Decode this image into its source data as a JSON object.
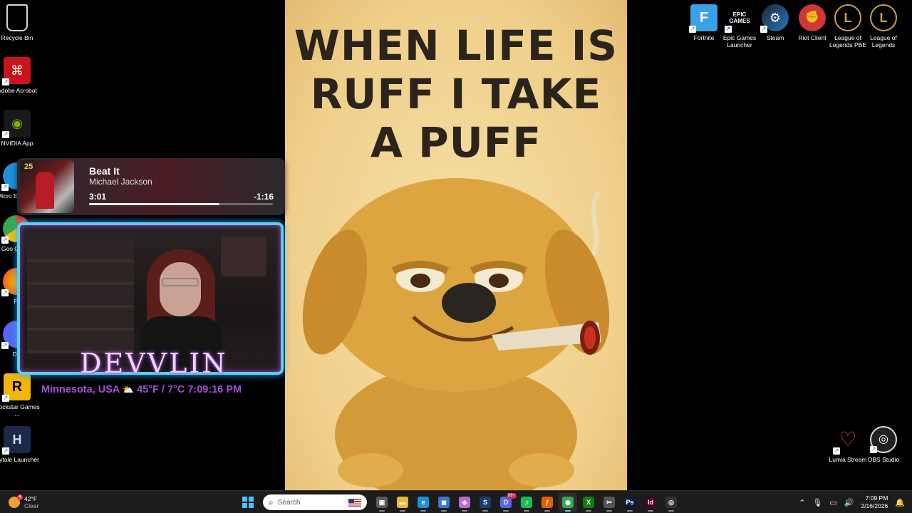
{
  "desktop_icons_left": [
    {
      "id": "recycle-bin",
      "label": "Recycle Bin"
    },
    {
      "id": "adobe-acrobat",
      "label": "Adobe Acrobat"
    },
    {
      "id": "nvidia-app",
      "label": "NVIDIA App"
    },
    {
      "id": "microsoft-edge",
      "label": "Micro Edg"
    },
    {
      "id": "google-chrome",
      "label": "Goo Chr"
    },
    {
      "id": "firefox",
      "label": "Fire"
    },
    {
      "id": "discord",
      "label": "Disc"
    },
    {
      "id": "rockstar-games",
      "label": "Rockstar Games ..."
    },
    {
      "id": "hytale-launcher",
      "label": "Hytale Launcher"
    }
  ],
  "desktop_icons_right_top": [
    {
      "id": "fortnite",
      "label": "Fortnite",
      "glyph": "F"
    },
    {
      "id": "epic-games-launcher",
      "label": "Epic Games Launcher",
      "glyph": "EPIC GAMES"
    },
    {
      "id": "steam",
      "label": "Steam",
      "glyph": "⚙"
    },
    {
      "id": "riot-client",
      "label": "Riot Client",
      "glyph": "✊"
    },
    {
      "id": "league-of-legends-pbe",
      "label": "League of Legends PBE",
      "glyph": "L"
    },
    {
      "id": "league-of-legends",
      "label": "League of Legends",
      "glyph": "L"
    }
  ],
  "desktop_icons_right_bottom": [
    {
      "id": "lumia-stream",
      "label": "Lumia Stream"
    },
    {
      "id": "obs-studio",
      "label": "OBS Studio"
    }
  ],
  "wallpaper": {
    "title_line1": "WHEN LIFE IS",
    "title_line2": "RUFF I TAKE",
    "title_line3": "A PUFF"
  },
  "media_player": {
    "album_badge": "25",
    "title": "Beat It",
    "artist": "Michael Jackson",
    "elapsed": "3:01",
    "remaining": "-1:16",
    "progress": 0.71
  },
  "stream_overlay": {
    "name": "DEVVLIN",
    "location": "Minnesota, USA",
    "weather_icon": "⛅",
    "temperature": "45°F / 7°C",
    "time": "7:09:16 PM"
  },
  "taskbar": {
    "weather_temp": "42°F",
    "weather_desc": "Clear",
    "weather_badge": "4",
    "search_placeholder": "Search",
    "apps": [
      {
        "id": "task-view",
        "glyph": "▣",
        "color": "#5a5a5a"
      },
      {
        "id": "file-explorer",
        "glyph": "▬",
        "color": "#e8b83a"
      },
      {
        "id": "edge",
        "glyph": "e",
        "color": "#1e8fd8"
      },
      {
        "id": "microsoft-store",
        "glyph": "◼",
        "color": "#3a78d8"
      },
      {
        "id": "copilot",
        "glyph": "◆",
        "color": "#c06ad8"
      },
      {
        "id": "steam",
        "glyph": "S",
        "color": "#1b3d6b"
      },
      {
        "id": "discord",
        "glyph": "D",
        "color": "#5865f2",
        "badge": "99+"
      },
      {
        "id": "spotify",
        "glyph": "♫",
        "color": "#1db954"
      },
      {
        "id": "firefox",
        "glyph": "ƒ",
        "color": "#e66000"
      },
      {
        "id": "chrome",
        "glyph": "◉",
        "color": "#34a853",
        "active": true
      },
      {
        "id": "xbox",
        "glyph": "X",
        "color": "#107c10"
      },
      {
        "id": "snipping-tool",
        "glyph": "✂",
        "color": "#555555"
      },
      {
        "id": "photoshop",
        "glyph": "Ps",
        "color": "#0b1b3a"
      },
      {
        "id": "indesign",
        "glyph": "Id",
        "color": "#49021f"
      },
      {
        "id": "obs",
        "glyph": "◎",
        "color": "#333333"
      }
    ],
    "clock_time": "7:09 PM",
    "clock_date": "2/16/2026"
  }
}
